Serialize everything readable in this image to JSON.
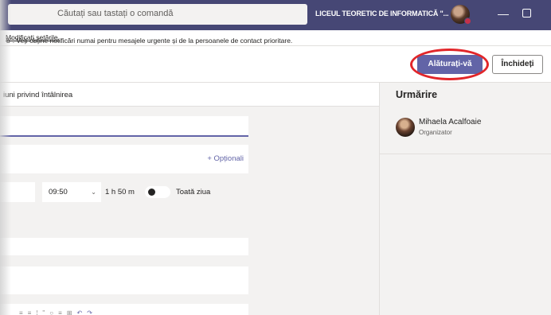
{
  "titlebar": {
    "search_placeholder": "Căutați sau tastați o comandă",
    "org_name": "LICEUL TEORETIC DE INFORMATICĂ \"...",
    "org_chevron": "⌄",
    "minimize_glyph": "—"
  },
  "banner": {
    "text": "b\". Veți obține notificări numai pentru mesajele urgente și de la persoanele de contact prioritare.",
    "link": "Modificați setările."
  },
  "toolbar": {
    "join_label": "Alăturați-vă",
    "close_label": "Închideți"
  },
  "tabs": {
    "details_label": "iuni privind întâlnirea"
  },
  "tracking": {
    "title": "Urmărire",
    "people": [
      {
        "name": "Mihaela Acalfoaie",
        "role": "Organizator"
      }
    ]
  },
  "form": {
    "attendees_optional_label": "+ Opționali",
    "end_time": "09:50",
    "time_chevron": "⌄",
    "duration": "1 h 50 m",
    "all_day_label": "Toată ziua"
  },
  "colors": {
    "titlebar": "#464775",
    "accent": "#6264a7",
    "highlight_ring": "#e2262a",
    "presence_busy": "#c4314b"
  }
}
